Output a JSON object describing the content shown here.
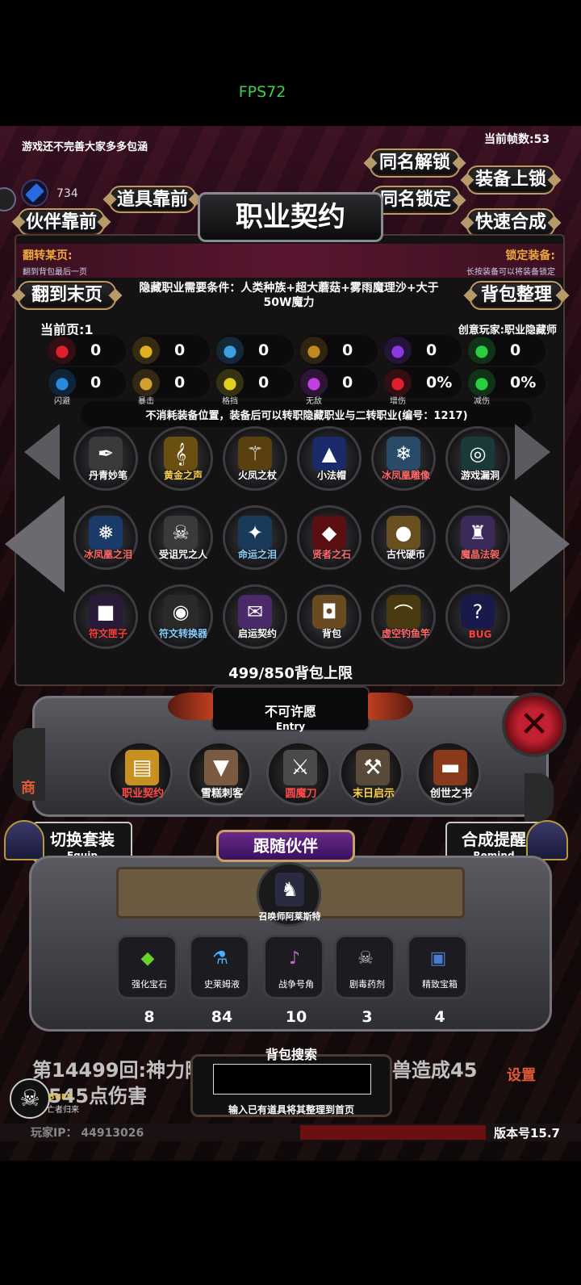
{
  "status": {
    "fps": "FPS72",
    "frame_label": "当前帧数:53",
    "notice": "游戏还不完善大家多多包涵"
  },
  "currency": {
    "gem_value": "734"
  },
  "top_buttons": {
    "same_name_unlock": "同名解锁",
    "equip_lock": "装备上锁",
    "same_name_lock": "同名锁定",
    "quick_merge": "快速合成",
    "items_front": "道具靠前",
    "partner_front": "伙伴靠前",
    "to_last_page": "翻到末页",
    "bag_sort": "背包整理"
  },
  "dialog": {
    "title": "职业契约",
    "flip_page_label": "翻转某页:",
    "flip_page_hint": "翻到背包最后一页",
    "lock_equip_label": "锁定装备:",
    "lock_equip_hint": "长按装备可以将装备锁定",
    "requirement": "隐藏职业需要条件：人类种族+超大蘑菇+雾雨魔理沙+大于50W魔力",
    "current_page": "当前页:1",
    "creator": "创意玩家:职业隐藏师",
    "description": "不消耗装备位置，装备后可以转职隐藏职业与二转职业(编号：1217)"
  },
  "stats": [
    {
      "icon": "heart-icon",
      "value": "0",
      "label": "",
      "color": "#e02030"
    },
    {
      "icon": "strength-icon",
      "value": "0",
      "label": "",
      "color": "#e0b020"
    },
    {
      "icon": "speed-icon",
      "value": "0",
      "label": "",
      "color": "#3aa0e0"
    },
    {
      "icon": "attack-icon",
      "value": "0",
      "label": "",
      "color": "#c08a20"
    },
    {
      "icon": "lightning-icon",
      "value": "0",
      "label": "",
      "color": "#8a3ae0"
    },
    {
      "icon": "luck-icon",
      "value": "0",
      "label": "",
      "color": "#2ad040"
    },
    {
      "icon": "dodge-icon",
      "value": "0",
      "label": "闪避",
      "color": "#2a8ae0"
    },
    {
      "icon": "crit-icon",
      "value": "0",
      "label": "暴击",
      "color": "#d0a030"
    },
    {
      "icon": "block-icon",
      "value": "0",
      "label": "格挡",
      "color": "#e0d020"
    },
    {
      "icon": "invincible-icon",
      "value": "0",
      "label": "无敌",
      "color": "#c040e0"
    },
    {
      "icon": "damage-up-icon",
      "value": "0%",
      "label": "增伤",
      "color": "#e02030"
    },
    {
      "icon": "damage-reduce-icon",
      "value": "0%",
      "label": "减伤",
      "color": "#2ad040"
    }
  ],
  "items": [
    {
      "name": "丹青妙笔",
      "color": "#fff",
      "icon": "brush-icon",
      "glyph": "✒",
      "bg": "#3a3a3a"
    },
    {
      "name": "黄金之声",
      "color": "#ffd24a",
      "icon": "harp-icon",
      "glyph": "𝄞",
      "bg": "#6a5010"
    },
    {
      "name": "火凤之杖",
      "color": "#fff",
      "icon": "staff-icon",
      "glyph": "⚚",
      "bg": "#5a4010"
    },
    {
      "name": "小法帽",
      "color": "#fff",
      "icon": "wizard-hat-icon",
      "glyph": "▲",
      "bg": "#1a2a6a"
    },
    {
      "name": "冰凤凰雕像",
      "color": "#ff6a6a",
      "icon": "ice-phoenix-icon",
      "glyph": "❄",
      "bg": "#2a4a6a"
    },
    {
      "name": "游戏漏洞",
      "color": "#fff",
      "icon": "portal-icon",
      "glyph": "◎",
      "bg": "#1a3a3a"
    },
    {
      "name": "冰凤凰之泪",
      "color": "#ff6a6a",
      "icon": "ice-crystal-icon",
      "glyph": "❅",
      "bg": "#1a3a6a"
    },
    {
      "name": "受诅咒之人",
      "color": "#fff",
      "icon": "cursed-man-icon",
      "glyph": "☠",
      "bg": "#3a3a3a"
    },
    {
      "name": "命运之泪",
      "color": "#8ad0ff",
      "icon": "fate-tear-icon",
      "glyph": "✦",
      "bg": "#1a3a5a"
    },
    {
      "name": "贤者之石",
      "color": "#ff6a6a",
      "icon": "sage-stone-icon",
      "glyph": "◆",
      "bg": "#5a1010"
    },
    {
      "name": "古代硬币",
      "color": "#fff",
      "icon": "coin-icon",
      "glyph": "●",
      "bg": "#6a5020"
    },
    {
      "name": "魔晶法袈",
      "color": "#ff6a6a",
      "icon": "mage-robe-icon",
      "glyph": "♜",
      "bg": "#3a2a5a"
    },
    {
      "name": "符文匣子",
      "color": "#ff4040",
      "icon": "rune-box-icon",
      "glyph": "■",
      "bg": "#2a1a3a"
    },
    {
      "name": "符文转换器",
      "color": "#8ad0ff",
      "icon": "rune-converter-icon",
      "glyph": "◉",
      "bg": "#2a2a2a"
    },
    {
      "name": "启运契约",
      "color": "#fff",
      "icon": "scroll-icon",
      "glyph": "✉",
      "bg": "#4a2a6a"
    },
    {
      "name": "背包",
      "color": "#fff",
      "icon": "backpack-icon",
      "glyph": "◘",
      "bg": "#6a4a20"
    },
    {
      "name": "虚空钓鱼竿",
      "color": "#ff6a6a",
      "icon": "fishing-rod-icon",
      "glyph": "⌒",
      "bg": "#4a3a10"
    },
    {
      "name": "BUG",
      "color": "#ff4040",
      "icon": "bug-icon",
      "glyph": "?",
      "bg": "#1a1a4a"
    }
  ],
  "bag": {
    "capacity": "499/850背包上限"
  },
  "wish": {
    "title": "不可许愿",
    "subtitle": "Entry"
  },
  "tools": [
    {
      "name": "职业契约",
      "color": "#ff4a4a",
      "icon": "contract-scroll-icon",
      "glyph": "▤",
      "bg": "#c89020"
    },
    {
      "name": "雪糕刺客",
      "color": "#fff",
      "icon": "ice-cream-icon",
      "glyph": "▼",
      "bg": "#7a5a40"
    },
    {
      "name": "圆魔刀",
      "color": "#ff4a4a",
      "icon": "sword-icon",
      "glyph": "⚔",
      "bg": "#4a4a4a"
    },
    {
      "name": "末日启示",
      "color": "#ffd24a",
      "icon": "axe-icon",
      "glyph": "⚒",
      "bg": "#5a4a3a"
    },
    {
      "name": "创世之书",
      "color": "#fff",
      "icon": "book-icon",
      "glyph": "▬",
      "bg": "#8a3a1a"
    }
  ],
  "switch_set": {
    "label": "切换套装",
    "sub": "Equip"
  },
  "merge_remind": {
    "label": "合成提醒",
    "sub": "Remind"
  },
  "partner": {
    "title": "跟随伙伴",
    "name": "召唤师阿莱斯特"
  },
  "consumables": [
    {
      "name": "强化宝石",
      "count": "8",
      "icon": "gem-icon",
      "glyph": "◆",
      "color": "#6ad02a"
    },
    {
      "name": "史莱姆液",
      "count": "84",
      "icon": "potion-icon",
      "glyph": "⚗",
      "color": "#4ab0ff"
    },
    {
      "name": "战争号角",
      "count": "10",
      "icon": "horn-icon",
      "glyph": "♪",
      "color": "#c06ad0"
    },
    {
      "name": "剧毒药剂",
      "count": "3",
      "icon": "poison-icon",
      "glyph": "☠",
      "color": "#c0c0d0"
    },
    {
      "name": "精致宝箱",
      "count": "4",
      "icon": "chest-icon",
      "glyph": "▣",
      "color": "#4a7ad0"
    }
  ],
  "log": {
    "line1": "第14499回:神力附",
    "line1b": "兽造成45",
    "line2": "545点伤害"
  },
  "search": {
    "title": "背包搜索",
    "hint": "输入已有道具将其整理到首页",
    "placeholder": ""
  },
  "buff": {
    "label": "BUFF",
    "sub": "亡者归来"
  },
  "side": {
    "shop": "商",
    "settings": "设置"
  },
  "footer": {
    "player_ip": "玩家IP：  44913026",
    "version": "版本号15.7"
  }
}
